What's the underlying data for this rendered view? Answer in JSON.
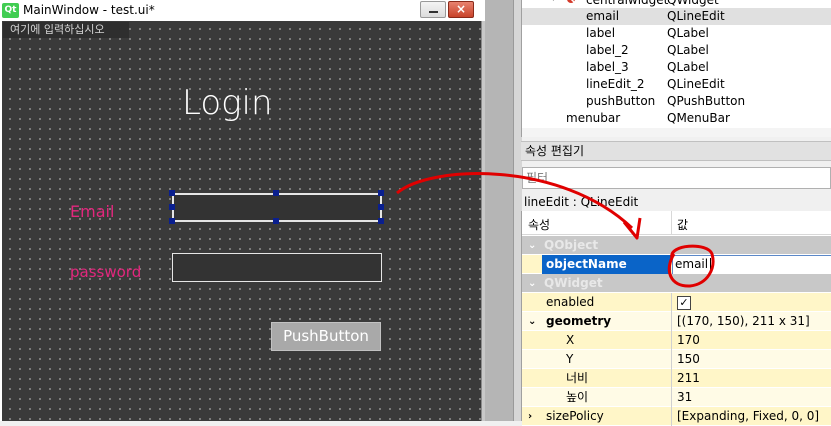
{
  "window": {
    "logo": "Qt",
    "title": "MainWindow - test.ui*",
    "minimize_icon": "minimize-icon",
    "close_label": "×"
  },
  "form": {
    "menubar_placeholder": "여기에 입력하십시오",
    "title": "Login",
    "email_label": "Email",
    "password_label": "password",
    "push_button": "PushButton"
  },
  "object_tree": {
    "partial_top": {
      "name": "centralwidget",
      "class": "QWidget"
    },
    "items": [
      {
        "name": "email",
        "class": "QLineEdit",
        "selected": true
      },
      {
        "name": "label",
        "class": "QLabel"
      },
      {
        "name": "label_2",
        "class": "QLabel"
      },
      {
        "name": "label_3",
        "class": "QLabel"
      },
      {
        "name": "lineEdit_2",
        "class": "QLineEdit"
      },
      {
        "name": "pushButton",
        "class": "QPushButton"
      }
    ],
    "menubar": {
      "name": "menubar",
      "class": "QMenuBar"
    }
  },
  "property_editor": {
    "header": "속성 편집기",
    "filter_placeholder": "필터",
    "class_label": "lineEdit : QLineEdit",
    "col_property": "속성",
    "col_value": "값",
    "rows": {
      "qobject_group": "QObject",
      "objectname_name": "objectName",
      "objectname_value": "email",
      "qwidget_group": "QWidget",
      "enabled_name": "enabled",
      "enabled_check": "✓",
      "geometry_name": "geometry",
      "geometry_value": "[(170, 150), 211 x 31]",
      "x_name": "X",
      "x_value": "170",
      "y_name": "Y",
      "y_value": "150",
      "width_name": "너비",
      "width_value": "211",
      "height_name": "높이",
      "height_value": "31",
      "sizepolicy_name": "sizePolicy",
      "sizepolicy_value": "[Expanding, Fixed, 0, 0]"
    }
  },
  "colors": {
    "accent_pink": "#e2277d",
    "annotation_red": "#e00000",
    "selection_blue": "#0a64c8"
  }
}
